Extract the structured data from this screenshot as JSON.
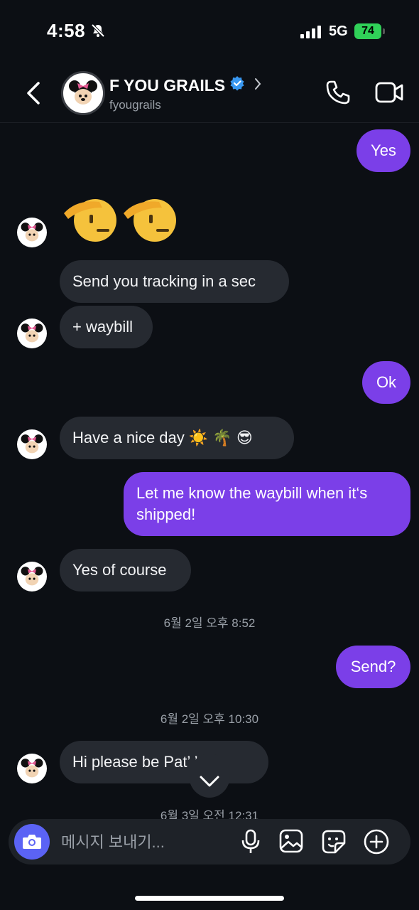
{
  "status": {
    "time": "4:58",
    "network": "5G",
    "battery": "74"
  },
  "header": {
    "name": "F YOU GRAILS",
    "username": "fyougrails"
  },
  "messages": {
    "m1": "Yes",
    "m2": "Send you tracking in a sec",
    "m3": "+ waybill",
    "m4": "Ok",
    "m5": "Have a nice day ☀️ 🌴 😎",
    "m6_line1": "Let me know the waybill when it‘s",
    "m6_line2": "shipped!",
    "m7": "Yes of course",
    "m8": "Send?",
    "m9": "Hi please be Pat’ ’ 🫶🏼"
  },
  "timestamps": {
    "t1": "6월 2일 오후 8:52",
    "t2": "6월 2일 오후 10:30",
    "t3": "6월 3일 오전 12:31"
  },
  "composer": {
    "placeholder": "메시지 보내기..."
  },
  "icons": [
    "back-icon",
    "verified-icon",
    "chevron-right-icon",
    "phone-icon",
    "video-icon",
    "camera-icon",
    "microphone-icon",
    "gallery-icon",
    "sticker-icon",
    "plus-icon",
    "chevron-down-icon",
    "bell-off-icon",
    "salute-emoji"
  ],
  "colors": {
    "background": "#0c0f14",
    "outgoing_bubble": "#7b3fe8",
    "incoming_bubble": "#262a31",
    "camera_button": "#5b63f5",
    "battery": "#30d158",
    "verified": "#3897f0"
  }
}
